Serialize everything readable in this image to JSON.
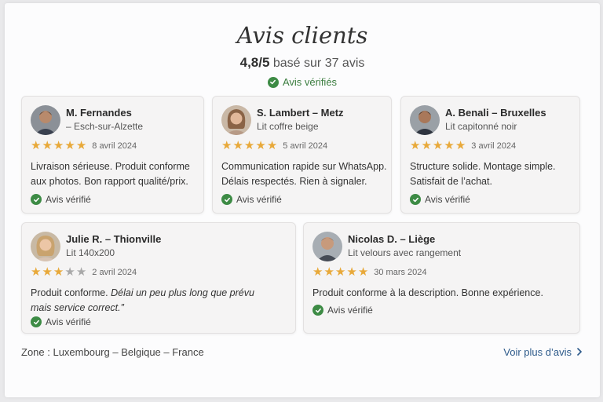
{
  "header": {
    "title": "Avis clients",
    "score": "4,8/5",
    "based_on": "basé sur 37 avis",
    "verified": "Avis vérifiés"
  },
  "reviews": [
    {
      "name": "M. Fernandes",
      "product": "– Esch-sur-Alzette",
      "stars": 5,
      "date": "8 avril 2024",
      "line1": "Livraison sérieuse. Produit conforme",
      "line2": "aux photos. Bon rapport qualité/prix.",
      "badge": "Avis vérifié",
      "avatar": "male-dark-hair"
    },
    {
      "name": "S. Lambert – Metz",
      "product": "Lit coffre beige",
      "stars": 5,
      "date": "5 avril 2024",
      "line1": "Communication rapide sur WhatsApp.",
      "line2": "Délais respectés. Rien à signaler.",
      "badge": "Avis vérifié",
      "avatar": "female-brown-hair"
    },
    {
      "name": "A. Benali – Bruxelles",
      "product": "Lit capitonné noir",
      "stars": 5,
      "date": "3 avril 2024",
      "line1": "Structure solide. Montage simple.",
      "line2": "Satisfait de l’achat.",
      "badge": "Avis vérifié",
      "avatar": "male-dark-hair"
    },
    {
      "name": "Julie R. – Thionville",
      "product": "Lit 140x200",
      "stars": 3,
      "date": "2 avril 2024",
      "line1_plain": "Produit conforme. ",
      "line1_italic": "Délai un peu plus long que prévu",
      "line2": "mais service correct.”",
      "badge": "Avis vérifié",
      "avatar": "female-blonde-hair"
    },
    {
      "name": "Nicolas D. – Liège",
      "product": "Lit velours avec rangement",
      "stars": 5,
      "date": "30 mars 2024",
      "line1": "Produit conforme à la description.  Bonne expérience.",
      "badge": "Avis vérifié",
      "avatar": "male-short-hair"
    }
  ],
  "footer": {
    "zone": "Zone : Luxembourg – Belgique – France",
    "more": "Voir plus d’avis",
    "more_icon": "chevron-right-icon"
  },
  "colors": {
    "star": "#e8a93a",
    "star_off": "#a9a9a9",
    "verified": "#3d8b45",
    "link": "#2d5a8a"
  }
}
